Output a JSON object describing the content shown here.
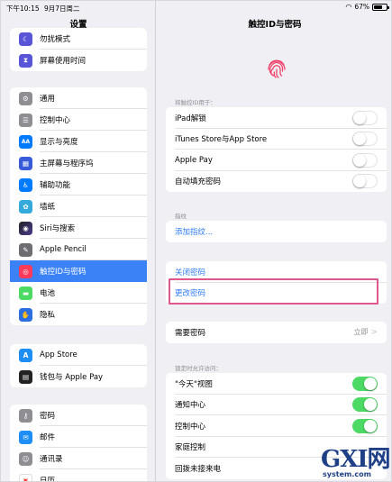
{
  "status_bar": {
    "time": "下午10:15",
    "date": "9月7日周二",
    "battery": "67%",
    "battery_fraction": 0.67
  },
  "sidebar": {
    "title": "设置",
    "group1": [
      {
        "label": "勿扰模式",
        "icon": "moon-icon",
        "color": "#5856d6"
      },
      {
        "label": "屏幕使用时间",
        "icon": "hourglass-icon",
        "color": "#5856d6"
      }
    ],
    "group2": [
      {
        "label": "通用",
        "icon": "gear-icon",
        "color": "#8e8e93"
      },
      {
        "label": "控制中心",
        "icon": "switches-icon",
        "color": "#8e8e93"
      },
      {
        "label": "显示与亮度",
        "icon": "text-size-icon",
        "color": "#007aff"
      },
      {
        "label": "主屏幕与程序坞",
        "icon": "grid-icon",
        "color": "#3a5bd9"
      },
      {
        "label": "辅助功能",
        "icon": "accessibility-icon",
        "color": "#007aff"
      },
      {
        "label": "墙纸",
        "icon": "flower-icon",
        "color": "#34aadc"
      },
      {
        "label": "Siri与搜索",
        "icon": "siri-icon",
        "color": "#222222"
      },
      {
        "label": "Apple Pencil",
        "icon": "pencil-icon",
        "color": "#6d6d72"
      },
      {
        "label": "触控ID与密码",
        "icon": "fingerprint-icon",
        "color": "#ff3b5c"
      },
      {
        "label": "电池",
        "icon": "battery-icon",
        "color": "#4cd964"
      },
      {
        "label": "隐私",
        "icon": "hand-icon",
        "color": "#2a6ee0"
      }
    ],
    "group3": [
      {
        "label": "App Store",
        "icon": "app-store-icon",
        "color": "#1e8ef5"
      },
      {
        "label": "钱包与 Apple Pay",
        "icon": "wallet-icon",
        "color": "#222222"
      }
    ],
    "group4": [
      {
        "label": "密码",
        "icon": "key-icon",
        "color": "#8e8e93"
      },
      {
        "label": "邮件",
        "icon": "mail-icon",
        "color": "#1e8ef5"
      },
      {
        "label": "通讯录",
        "icon": "contacts-icon",
        "color": "#8e8e93"
      },
      {
        "label": "日历",
        "icon": "calendar-icon",
        "color": "#ff3b30"
      }
    ],
    "active_label": "触控ID与密码"
  },
  "main": {
    "title": "触控ID与密码",
    "section_use_for": "将触控ID用于：",
    "use_for_rows": [
      {
        "label": "iPad解锁",
        "on": false
      },
      {
        "label": "iTunes Store与App Store",
        "on": false
      },
      {
        "label": "Apple Pay",
        "on": false
      },
      {
        "label": "自动填充密码",
        "on": false
      }
    ],
    "section_fingerprints": "指纹",
    "add_fingerprint": "添加指纹...",
    "turn_off_passcode": "关闭密码",
    "change_passcode": "更改密码",
    "require_passcode": {
      "label": "需要密码",
      "value": "立即",
      "chevron": ">"
    },
    "section_locked_access": "锁定时允许访问：",
    "locked_rows": [
      {
        "label": "\"今天\"视图",
        "on": true
      },
      {
        "label": "通知中心",
        "on": true
      },
      {
        "label": "控制中心",
        "on": true
      },
      {
        "label": "家庭控制",
        "on": null
      },
      {
        "label": "回拨未接来电",
        "on": null
      }
    ]
  },
  "watermark": {
    "logo": "GXI网",
    "site": "system.com"
  }
}
